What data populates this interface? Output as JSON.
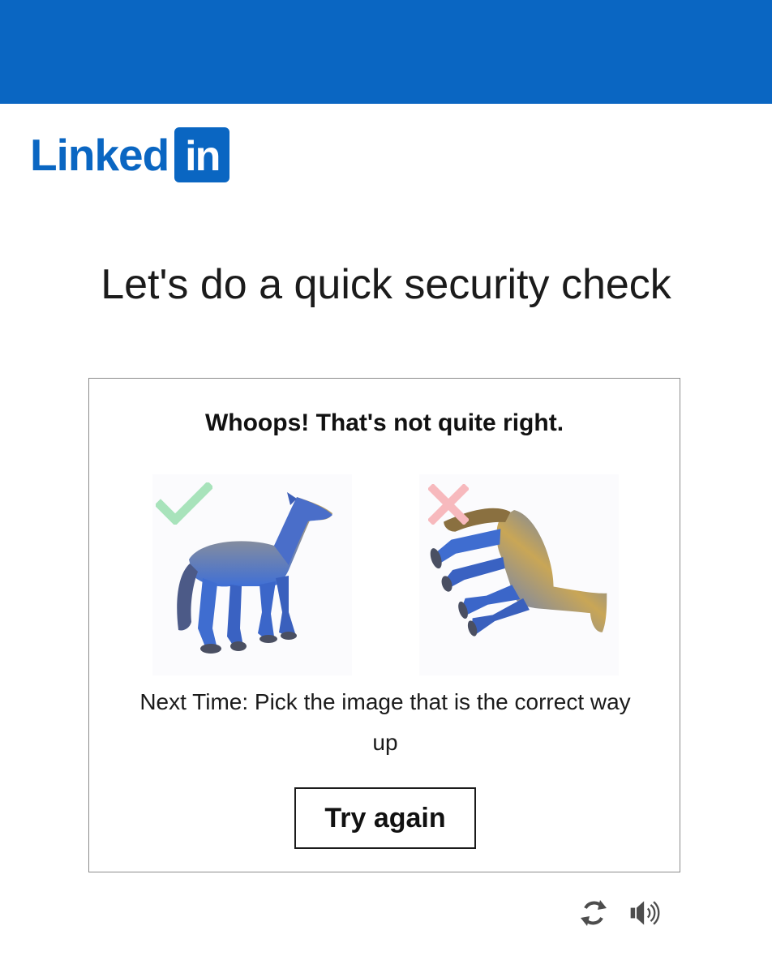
{
  "brand": {
    "wordmark": "Linked",
    "badge": "in",
    "color": "#0a66c2"
  },
  "page": {
    "title": "Let's do a quick security check"
  },
  "challenge": {
    "heading": "Whoops! That's not quite right.",
    "instruction": "Next Time: Pick the image that is the correct way up",
    "try_again_label": "Try again",
    "choices": [
      {
        "image": "horse upright",
        "status": "correct",
        "icon": "check-icon",
        "color": "#a8e3bb"
      },
      {
        "image": "horse rotated",
        "status": "incorrect",
        "icon": "cross-icon",
        "color": "#f7b9bd"
      }
    ]
  },
  "utilities": {
    "refresh_icon": "refresh-icon",
    "audio_icon": "audio-icon"
  }
}
